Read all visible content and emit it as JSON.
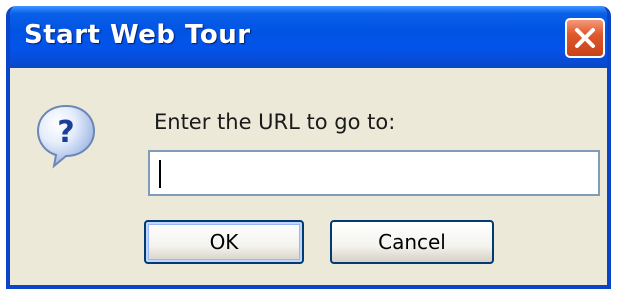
{
  "dialog": {
    "title": "Start Web Tour",
    "prompt": "Enter the URL to go to:",
    "url_input": {
      "value": "",
      "placeholder": ""
    },
    "buttons": {
      "ok_label": "OK",
      "cancel_label": "Cancel"
    },
    "icons": {
      "dialog_icon": "question-icon",
      "close": "close-icon"
    }
  },
  "colors": {
    "titlebar": "#0054e3",
    "window_frame": "#0a44c9",
    "dialog_bg": "#ece9d8",
    "close_button": "#e0582c",
    "input_border": "#7f9db9",
    "button_border": "#003c74"
  }
}
